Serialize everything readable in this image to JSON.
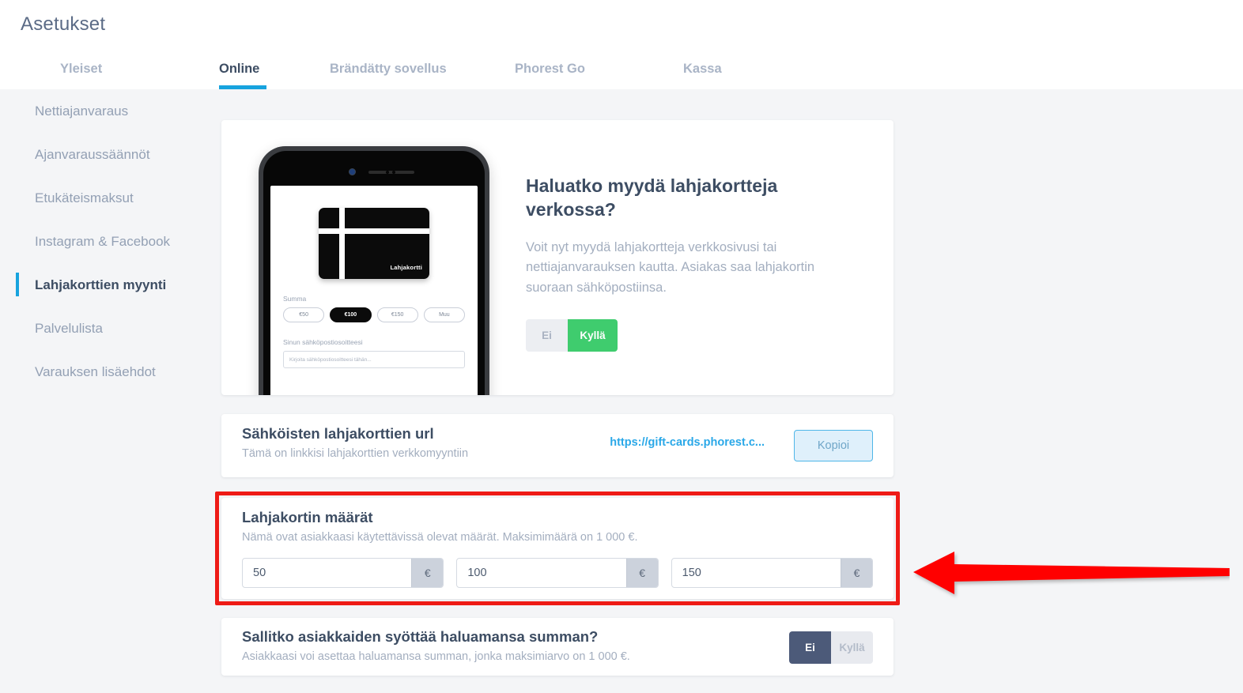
{
  "header": {
    "title": "Asetukset"
  },
  "tabs": [
    {
      "label": "Yleiset",
      "active": false
    },
    {
      "label": "Online",
      "active": true
    },
    {
      "label": "Brändätty sovellus",
      "active": false
    },
    {
      "label": "Phorest Go",
      "active": false
    },
    {
      "label": "Kassa",
      "active": false
    }
  ],
  "sidebar": {
    "items": [
      {
        "label": "Nettiajanvaraus"
      },
      {
        "label": "Ajanvaraussäännöt"
      },
      {
        "label": "Etukäteismaksut"
      },
      {
        "label": "Instagram & Facebook"
      },
      {
        "label": "Lahjakorttien myynti"
      },
      {
        "label": "Palvelulista"
      },
      {
        "label": "Varauksen lisäehdot"
      }
    ],
    "active_index": 4
  },
  "hero": {
    "title": "Haluatko myydä lahjakortteja verkossa?",
    "body": "Voit nyt myydä lahjakortteja verkkosivusi tai nettiajanvarauksen kautta. Asiakas saa lahjakortin suoraan sähköpostiinsa.",
    "toggle": {
      "no": "Ei",
      "yes": "Kyllä",
      "selected": "Kyllä"
    },
    "phone": {
      "card_label": "Lahjakortti",
      "amount_label": "Summa",
      "chips": [
        {
          "label": "€50",
          "selected": false
        },
        {
          "label": "€100",
          "selected": true
        },
        {
          "label": "€150",
          "selected": false
        },
        {
          "label": "Muu",
          "selected": false
        }
      ],
      "email_label": "Sinun sähköpostiosoitteesi",
      "email_placeholder": "Kirjoita sähköpostiosoitteesi tähän..."
    }
  },
  "url_card": {
    "title": "Sähköisten lahjakorttien url",
    "subtitle": "Tämä on linkkisi lahjakorttien verkkomyyntiin",
    "url": "https://gift-cards.phorest.c...",
    "copy_label": "Kopioi"
  },
  "amount_card": {
    "title": "Lahjakortin määrät",
    "subtitle": "Nämä ovat asiakkaasi käytettävissä olevat määrät. Maksimimäärä on 1 000 €.",
    "fields": [
      {
        "value": "50",
        "suffix": "€"
      },
      {
        "value": "100",
        "suffix": "€"
      },
      {
        "value": "150",
        "suffix": "€"
      }
    ],
    "highlight_color": "#ee1b16"
  },
  "custom_card": {
    "title": "Sallitko asiakkaiden syöttää haluamansa summan?",
    "subtitle": "Asiakkaasi voi asettaa haluamansa summan, jonka maksimiarvo on 1 000 €.",
    "toggle": {
      "no": "Ei",
      "yes": "Kyllä",
      "selected": "Ei"
    }
  },
  "annotation": {
    "arrow_color": "#ff0000",
    "arrow_direction": "left"
  },
  "colors": {
    "accent_blue": "#17a3de",
    "green": "#3fcc6e",
    "dark_slate": "#4c5a79",
    "page_bg": "#f4f5f7"
  }
}
